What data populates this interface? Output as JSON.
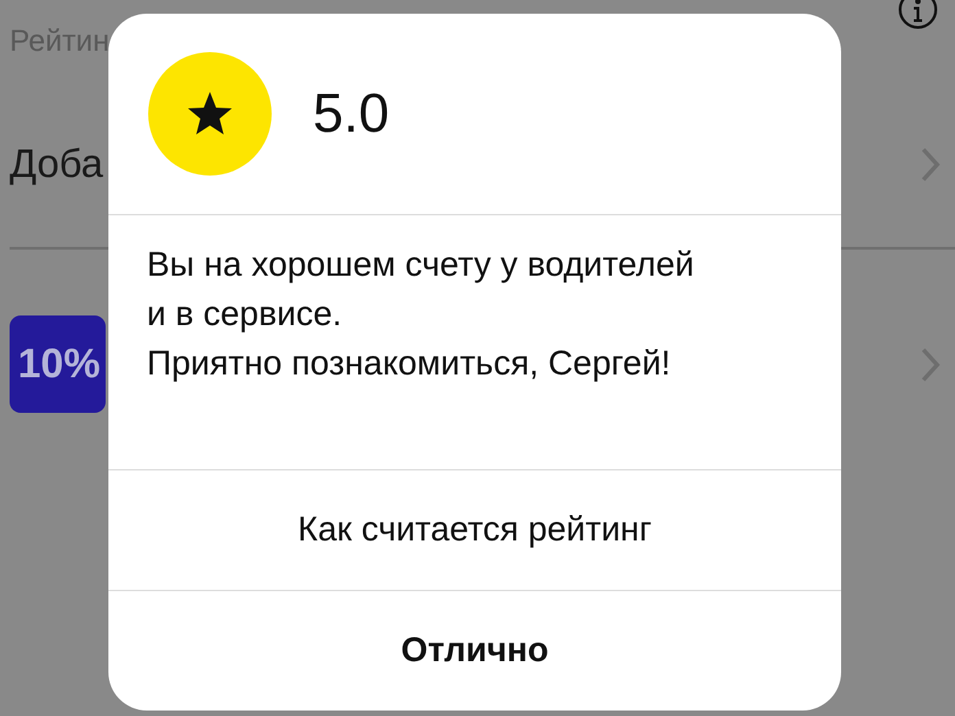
{
  "background": {
    "rating_label": "Рейтин",
    "add_row": {
      "label": "Доба"
    },
    "promo_row": {
      "badge": "10%"
    }
  },
  "dialog": {
    "rating": "5.0",
    "message": [
      "Вы на хорошем счету у водителей",
      "и в сервисе.",
      "Приятно познакомиться, Сергей!"
    ],
    "buttons": [
      {
        "label": "Как считается рейтинг",
        "kind": "link"
      },
      {
        "label": "Отлично",
        "kind": "primary"
      }
    ]
  }
}
